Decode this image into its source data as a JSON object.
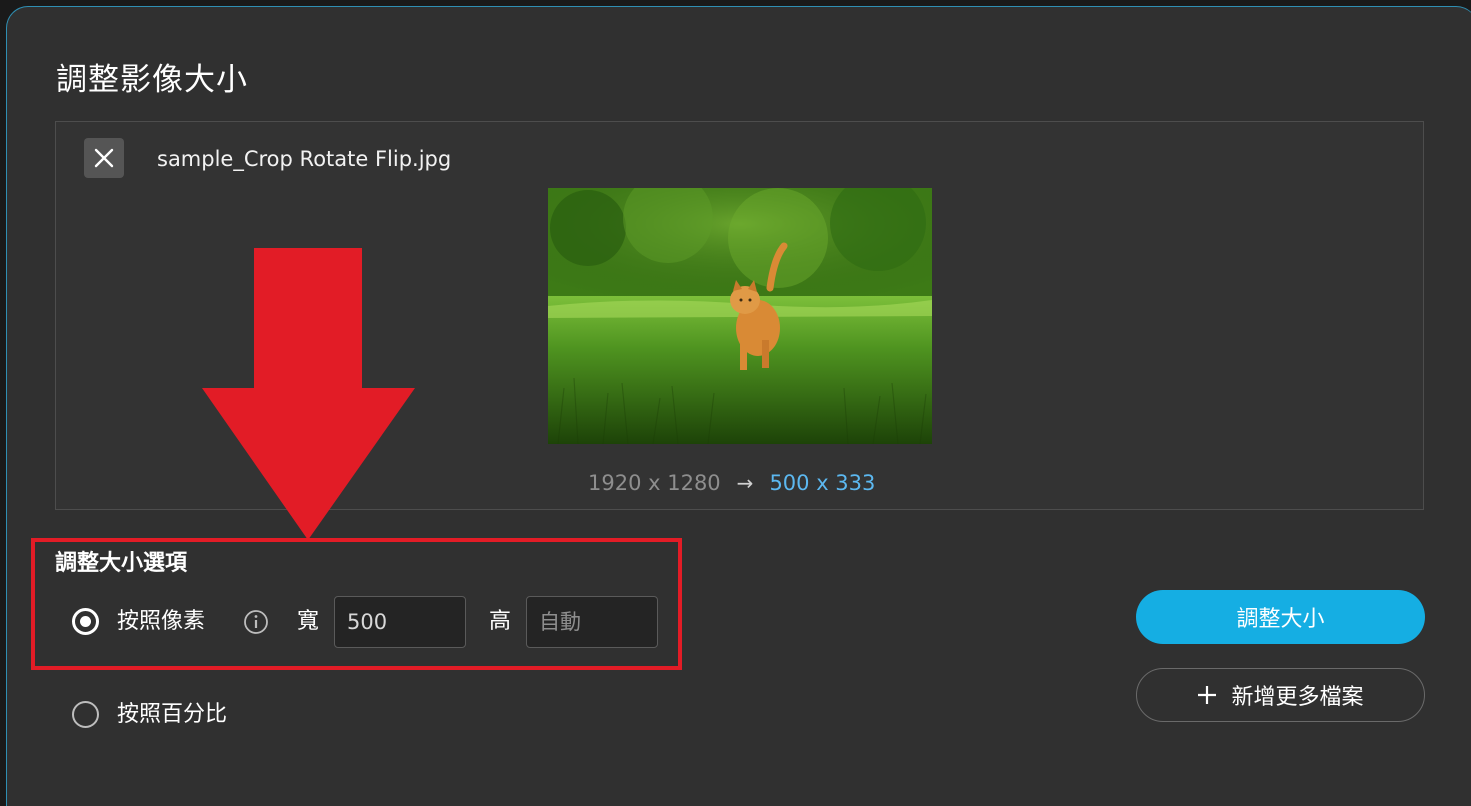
{
  "dialog": {
    "title": "調整影像大小"
  },
  "file": {
    "name": "sample_Crop Rotate Flip.jpg",
    "original_dims": "1920 x 1280",
    "arrow": "→",
    "target_dims": "500 x 333"
  },
  "options": {
    "heading": "調整大小選項",
    "by_pixels_label": "按照像素",
    "width_label": "寬",
    "width_value": "500",
    "height_label": "高",
    "height_placeholder": "自動",
    "by_percent_label": "按照百分比",
    "selected": "by_pixels"
  },
  "actions": {
    "resize_label": "調整大小",
    "add_files_label": "新增更多檔案"
  },
  "colors": {
    "background": "#303030",
    "accent": "#15aee3",
    "target_dims": "#5cb8f0",
    "annotation_red": "#e21c26"
  }
}
